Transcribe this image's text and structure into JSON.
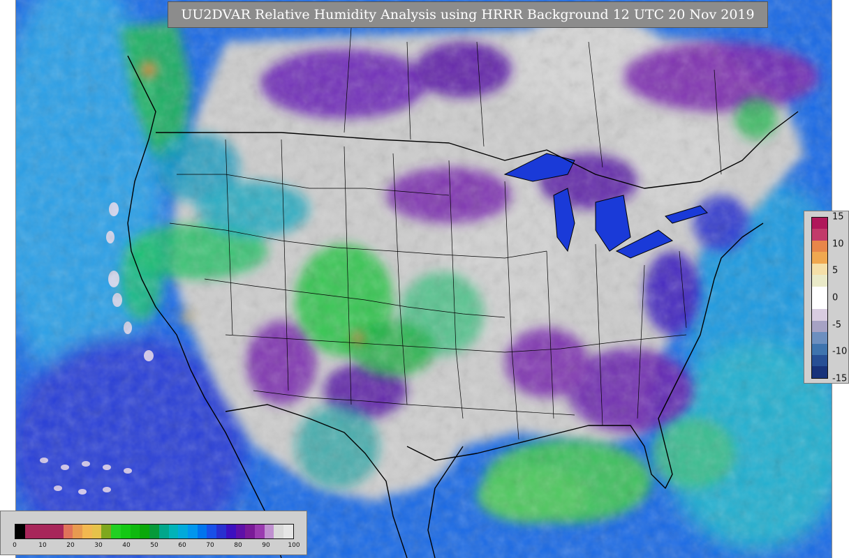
{
  "map": {
    "title": "UU2DVAR Relative Humidity Analysis using HRRR Background 12 UTC 20 Nov 2019"
  },
  "legend_difference": {
    "ticks": [
      "15",
      "10",
      "5",
      "0",
      "-5",
      "-10",
      "-15"
    ],
    "colors": [
      "#b0175a",
      "#c23a6a",
      "#e8864a",
      "#f0a850",
      "#f5dfa8",
      "#eaeac8",
      "#ffffff",
      "#ffffff",
      "#d8cce0",
      "#a6a2c4",
      "#6d8fbf",
      "#3f74ae",
      "#274f95",
      "#17327a"
    ]
  },
  "legend_rh": {
    "ticks": [
      "0",
      "10",
      "20",
      "30",
      "40",
      "50",
      "60",
      "70",
      "80",
      "90",
      "100"
    ],
    "colors": [
      "#000000",
      "#a8265a",
      "#a8265a",
      "#a8265a",
      "#a8265a",
      "#e0735a",
      "#e89a50",
      "#f2b850",
      "#e6c24a",
      "#7ea81e",
      "#22d022",
      "#14c814",
      "#0eb90e",
      "#0aa80a",
      "#069a3a",
      "#00a78b",
      "#00b3b8",
      "#00aadb",
      "#0096ee",
      "#0074ee",
      "#1850e8",
      "#2830d0",
      "#3c10c0",
      "#5e10a8",
      "#7a1a98",
      "#9a3ab0",
      "#c090d0",
      "#dadada",
      "#e6e6e6"
    ]
  }
}
